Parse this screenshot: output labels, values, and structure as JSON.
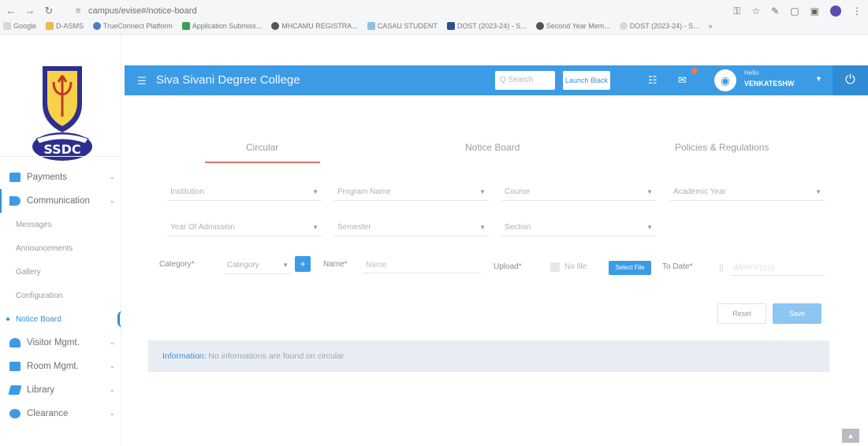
{
  "browser": {
    "url": "campus/evise#/notice-board",
    "bookmarks": [
      "Google",
      "D-ASMS",
      "TrueConnect Platform",
      "Application Submiss...",
      "MHCAMU REGISTRA...",
      "CASAU STUDENT",
      "DOST (2023-24) - S...",
      "Second Year Mem...",
      "DOST (2023-24) - S..."
    ],
    "more": "»"
  },
  "app": {
    "title": "Siva Sivani Degree College",
    "search_placeholder": "Q Search",
    "launch_label": "Launch Black",
    "user_greeting": "Hello",
    "user_name": "VENKATESHW",
    "accent": "#3c9be5"
  },
  "sidebar": {
    "logo_text": "SSDC",
    "items": [
      {
        "label": "Payments",
        "icon": "payments-icon"
      },
      {
        "label": "Communication",
        "icon": "communication-icon"
      },
      {
        "label": "Visitor Mgmt.",
        "icon": "visitor-icon"
      },
      {
        "label": "Room Mgmt.",
        "icon": "room-icon"
      },
      {
        "label": "Library",
        "icon": "library-icon"
      },
      {
        "label": "Clearance",
        "icon": "clearance-icon"
      }
    ],
    "sub_items": [
      "Messages",
      "Announcements",
      "Gallery",
      "Configuration",
      "Notice Board"
    ]
  },
  "tabs": [
    "Circular",
    "Notice Board",
    "Policies & Regulations"
  ],
  "filters": {
    "row1": [
      "Institution",
      "Program Name",
      "Course",
      "Academic Year"
    ],
    "row2": [
      "Year Of Admission",
      "Semester",
      "Section"
    ]
  },
  "form": {
    "category_label": "Category*",
    "category_placeholder": "Category",
    "add_symbol": "+",
    "name_label": "Name*",
    "name_placeholder": "Name",
    "upload_label": "Upload*",
    "no_file": "No file",
    "select_file": "Select File",
    "to_date_label": "To Date*",
    "to_date_placeholder": "dd/mm/yyyy"
  },
  "actions": {
    "reset": "Reset",
    "save": "Save"
  },
  "info": {
    "prefix": "Information:",
    "message": "No informations are found on circular"
  },
  "scroll_top": "▲"
}
